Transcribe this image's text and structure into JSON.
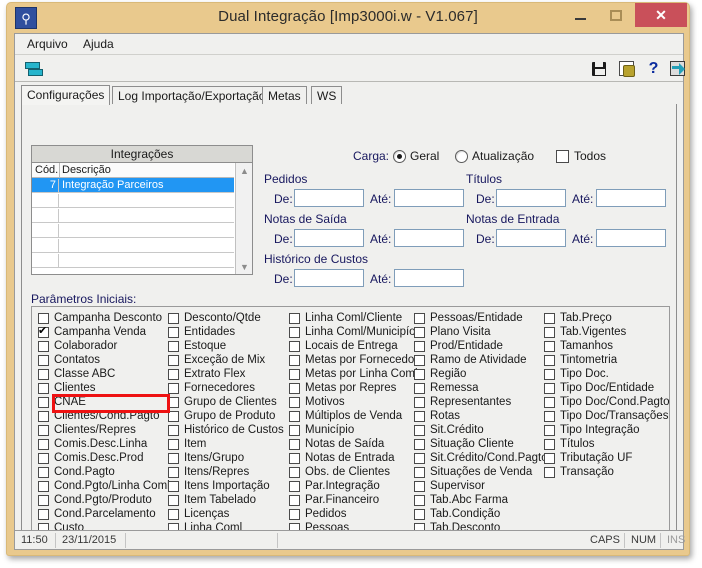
{
  "window": {
    "title": "Dual Integração [Imp3000i.w - V1.067]",
    "app_icon": "app-logo-icon",
    "minimize_label": "–",
    "maximize_label": "□",
    "close_label": "✕",
    "frame_color": "#e9c98d",
    "close_color": "#c9505a"
  },
  "menubar": {
    "items": [
      {
        "label": "Arquivo"
      },
      {
        "label": "Ajuda"
      }
    ]
  },
  "toolbar": {
    "left_icons": [
      {
        "name": "sync-integration-icon"
      }
    ],
    "right_icons": [
      {
        "name": "save-icon"
      },
      {
        "name": "export-icon"
      },
      {
        "name": "help-icon",
        "glyph": "?"
      },
      {
        "name": "exit-icon"
      }
    ]
  },
  "tabs": [
    {
      "label": "Configurações",
      "active": true
    },
    {
      "label": "Log Importação/Exportação",
      "active": false
    },
    {
      "label": "Metas",
      "active": false
    },
    {
      "label": "WS",
      "active": false
    }
  ],
  "grid": {
    "title": "Integrações",
    "columns": [
      "Cód.",
      "Descrição"
    ],
    "rows": [
      {
        "cod": "7",
        "desc": "Integração Parceiros",
        "selected": true
      },
      {
        "cod": "",
        "desc": "",
        "selected": false
      },
      {
        "cod": "",
        "desc": "",
        "selected": false
      },
      {
        "cod": "",
        "desc": "",
        "selected": false
      },
      {
        "cod": "",
        "desc": "",
        "selected": false
      },
      {
        "cod": "",
        "desc": "",
        "selected": false
      },
      {
        "cod": "",
        "desc": "",
        "selected": false
      }
    ],
    "scroll_up": "▲",
    "scroll_down": "▼",
    "selection_color": "#2196f3"
  },
  "options": {
    "carga_label": "Carga:",
    "radios": [
      {
        "label": "Geral",
        "checked": true
      },
      {
        "label": "Atualização",
        "checked": false
      }
    ],
    "todos": {
      "label": "Todos",
      "checked": false
    },
    "groups": [
      {
        "name": "Pedidos",
        "de_label": "De:",
        "de_value": "",
        "ate_label": "Até:",
        "ate_value": ""
      },
      {
        "name": "Títulos",
        "de_label": "De:",
        "de_value": "",
        "ate_label": "Até:",
        "ate_value": ""
      },
      {
        "name": "Notas de Saída",
        "de_label": "De:",
        "de_value": "",
        "ate_label": "Até:",
        "ate_value": ""
      },
      {
        "name": "Notas de Entrada",
        "de_label": "De:",
        "de_value": "",
        "ate_label": "Até:",
        "ate_value": ""
      },
      {
        "name": "Histórico de Custos",
        "de_label": "De:",
        "de_value": "",
        "ate_label": "Até:",
        "ate_value": ""
      }
    ]
  },
  "params": {
    "label": "Parâmetros Iniciais:",
    "columns": [
      {
        "items": [
          {
            "label": "Campanha Desconto",
            "checked": false
          },
          {
            "label": "Campanha Venda",
            "checked": true,
            "highlighted": true
          },
          {
            "label": "Colaborador",
            "checked": false
          },
          {
            "label": "Contatos",
            "checked": false
          },
          {
            "label": "Classe ABC",
            "checked": false
          },
          {
            "label": "Clientes",
            "checked": false
          },
          {
            "label": "CNAE",
            "checked": false
          },
          {
            "label": "Clientes/Cond.Pagto",
            "checked": false
          },
          {
            "label": "Clientes/Repres",
            "checked": false
          },
          {
            "label": "Comis.Desc.Linha",
            "checked": false
          },
          {
            "label": "Comis.Desc.Prod",
            "checked": false
          },
          {
            "label": "Cond.Pagto",
            "checked": false
          },
          {
            "label": "Cond.Pgto/Linha Coml",
            "checked": false
          },
          {
            "label": "Cond.Pgto/Produto",
            "checked": false
          },
          {
            "label": "Cond.Parcelamento",
            "checked": false
          },
          {
            "label": "Custo",
            "checked": false
          }
        ]
      },
      {
        "items": [
          {
            "label": "Desconto/Qtde",
            "checked": false
          },
          {
            "label": "Entidades",
            "checked": false
          },
          {
            "label": "Estoque",
            "checked": false
          },
          {
            "label": "Exceção de Mix",
            "checked": false
          },
          {
            "label": "Extrato Flex",
            "checked": false
          },
          {
            "label": "Fornecedores",
            "checked": false
          },
          {
            "label": "Grupo de Clientes",
            "checked": false
          },
          {
            "label": "Grupo de Produto",
            "checked": false
          },
          {
            "label": "Histórico de Custos",
            "checked": false
          },
          {
            "label": "Item",
            "checked": false
          },
          {
            "label": "Itens/Grupo",
            "checked": false
          },
          {
            "label": "Itens/Repres",
            "checked": false
          },
          {
            "label": "Itens Importação",
            "checked": false
          },
          {
            "label": "Item Tabelado",
            "checked": false
          },
          {
            "label": "Licenças",
            "checked": false
          },
          {
            "label": "Linha Coml",
            "checked": false
          }
        ]
      },
      {
        "items": [
          {
            "label": "Linha Coml/Cliente",
            "checked": false
          },
          {
            "label": "Linha Coml/Municipío",
            "checked": false
          },
          {
            "label": "Locais de Entrega",
            "checked": false
          },
          {
            "label": "Metas por Fornecedor",
            "checked": false
          },
          {
            "label": "Metas por Linha Coml.",
            "checked": false
          },
          {
            "label": "Metas por Repres",
            "checked": false
          },
          {
            "label": "Motivos",
            "checked": false
          },
          {
            "label": "Múltiplos de Venda",
            "checked": false
          },
          {
            "label": "Município",
            "checked": false
          },
          {
            "label": "Notas de Saída",
            "checked": false
          },
          {
            "label": "Notas de Entrada",
            "checked": false
          },
          {
            "label": "Obs. de Clientes",
            "checked": false
          },
          {
            "label": "Par.Integração",
            "checked": false
          },
          {
            "label": "Par.Financeiro",
            "checked": false
          },
          {
            "label": "Pedidos",
            "checked": false
          },
          {
            "label": "Pessoas",
            "checked": false
          }
        ]
      },
      {
        "items": [
          {
            "label": "Pessoas/Entidade",
            "checked": false
          },
          {
            "label": "Plano Visita",
            "checked": false
          },
          {
            "label": "Prod/Entidade",
            "checked": false
          },
          {
            "label": "Ramo de Atividade",
            "checked": false
          },
          {
            "label": "Região",
            "checked": false
          },
          {
            "label": "Remessa",
            "checked": false
          },
          {
            "label": "Representantes",
            "checked": false
          },
          {
            "label": "Rotas",
            "checked": false
          },
          {
            "label": "Sit.Crédito",
            "checked": false
          },
          {
            "label": "Situação Cliente",
            "checked": false
          },
          {
            "label": "Sit.Crédito/Cond.Pagto",
            "checked": false
          },
          {
            "label": "Situações de Venda",
            "checked": false
          },
          {
            "label": "Supervisor",
            "checked": false
          },
          {
            "label": "Tab.Abc Farma",
            "checked": false
          },
          {
            "label": "Tab.Condição",
            "checked": false
          },
          {
            "label": "Tab.Desconto",
            "checked": false
          }
        ]
      },
      {
        "items": [
          {
            "label": "Tab.Preço",
            "checked": false
          },
          {
            "label": "Tab.Vigentes",
            "checked": false
          },
          {
            "label": "Tamanhos",
            "checked": false
          },
          {
            "label": "Tintometria",
            "checked": false
          },
          {
            "label": "Tipo Doc.",
            "checked": false
          },
          {
            "label": "Tipo Doc/Entidade",
            "checked": false
          },
          {
            "label": "Tipo Doc/Cond.Pagto",
            "checked": false
          },
          {
            "label": "Tipo Doc/Transações",
            "checked": false
          },
          {
            "label": "Tipo Integração",
            "checked": false
          },
          {
            "label": "Títulos",
            "checked": false
          },
          {
            "label": "Tributação UF",
            "checked": false
          },
          {
            "label": "Transação",
            "checked": false
          }
        ]
      }
    ],
    "highlight_color": "#ee1111"
  },
  "statusbar": {
    "time": "11:50",
    "date": "23/11/2015",
    "caps": "CAPS",
    "num": "NUM",
    "ins": "INS"
  }
}
